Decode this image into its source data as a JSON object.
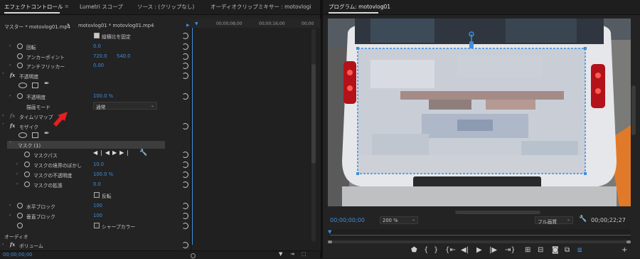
{
  "tabs": {
    "effect_controls": "エフェクトコントロール",
    "lumetri": "Lumetri スコープ",
    "source": "ソース : (クリップなし)",
    "audio_mixer": "オーディオクリップミキサー : motovlogi",
    "program": "プログラム: motovlog01"
  },
  "source_row": {
    "master": "マスター * motovlog01.mp4",
    "clip": "motovlog01 * motovlog01.mp4"
  },
  "timeline_ruler": [
    "00;00;08;00",
    "00;00;16;00",
    "00;00"
  ],
  "motion": {
    "uniform_scale": "縦横比を固定",
    "rotation": {
      "label": "回転",
      "value": "0.0"
    },
    "anchor": {
      "label": "アンカーポイント",
      "x": "720.0",
      "y": "540.0"
    },
    "antiflicker": {
      "label": "アンチフリッカー",
      "value": "0.00"
    }
  },
  "opacity": {
    "section": "不透明度",
    "label": "不透明度",
    "value": "100.0 %",
    "blend_label": "描画モード",
    "blend_value": "通常"
  },
  "time_remap": "タイムリマップ",
  "mosaic": {
    "section": "モザイク",
    "mask": "マスク (1)",
    "mask_path": "マスクパス",
    "feather": {
      "label": "マスクの境界のぼかし",
      "value": "10.0"
    },
    "mask_opacity": {
      "label": "マスクの不透明度",
      "value": "100.0 %"
    },
    "expansion": {
      "label": "マスクの拡張",
      "value": "0.0"
    },
    "inverted": "反転",
    "hblocks": {
      "label": "水平ブロック",
      "value": "100"
    },
    "vblocks": {
      "label": "垂直ブロック",
      "value": "100"
    },
    "sharp_colors": "シャープカラー"
  },
  "audio": {
    "section": "オーディオ",
    "volume": "ボリューム",
    "timecode": "00;00;00;00"
  },
  "program": {
    "timecode": "00;00;00;00",
    "zoom": "200 %",
    "quality": "フル画質",
    "duration": "00;00;22;27"
  },
  "colors": {
    "accent": "#3f8dde",
    "arrow": "#e5201f"
  }
}
